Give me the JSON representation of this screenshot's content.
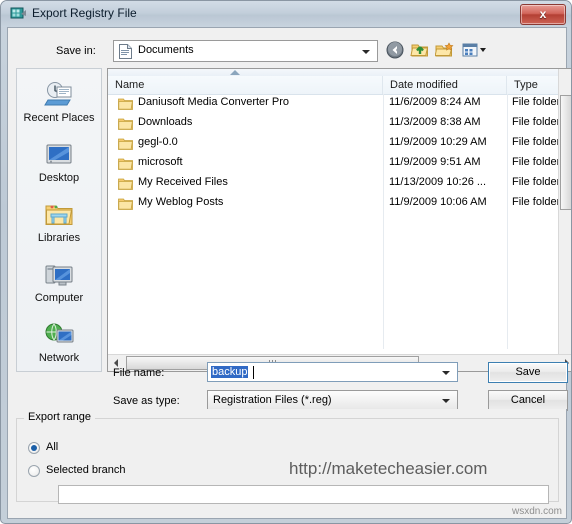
{
  "window": {
    "title": "Export Registry File",
    "title_icon": "registry-editor-icon",
    "close_label": "x"
  },
  "toolbar": {
    "save_in_label": "Save in:",
    "current_folder": "Documents",
    "folder_icon": "documents-icon",
    "buttons": [
      {
        "name": "back-button",
        "icon": "back-arrow-icon"
      },
      {
        "name": "up-one-level-button",
        "icon": "up-folder-icon"
      },
      {
        "name": "new-folder-button",
        "icon": "new-folder-icon"
      },
      {
        "name": "views-button",
        "icon": "views-icon"
      }
    ]
  },
  "places": {
    "items": [
      {
        "label": "Recent Places",
        "icon": "recent-places-icon"
      },
      {
        "label": "Desktop",
        "icon": "desktop-icon"
      },
      {
        "label": "Libraries",
        "icon": "libraries-icon"
      },
      {
        "label": "Computer",
        "icon": "computer-icon"
      },
      {
        "label": "Network",
        "icon": "network-icon"
      }
    ]
  },
  "filelist": {
    "columns": [
      "Name",
      "Date modified",
      "Type"
    ],
    "sort_column": "Name",
    "sort_direction": "ascending",
    "rows": [
      {
        "name": "Daniusoft Media Converter Pro",
        "date": "11/6/2009 8:24 AM",
        "type": "File folder"
      },
      {
        "name": "Downloads",
        "date": "11/3/2009 8:38 AM",
        "type": "File folder"
      },
      {
        "name": "gegl-0.0",
        "date": "11/9/2009 10:29 AM",
        "type": "File folder"
      },
      {
        "name": "microsoft",
        "date": "11/9/2009 9:51 AM",
        "type": "File folder"
      },
      {
        "name": "My Received Files",
        "date": "11/13/2009 10:26 ...",
        "type": "File folder"
      },
      {
        "name": "My Weblog Posts",
        "date": "11/9/2009 10:06 AM",
        "type": "File folder"
      }
    ]
  },
  "form": {
    "filename_label": "File name:",
    "filename_value": "backup",
    "filetype_label": "Save as type:",
    "filetype_value": "Registration Files (*.reg)",
    "save_label": "Save",
    "cancel_label": "Cancel"
  },
  "export_range": {
    "group_title": "Export range",
    "options": [
      {
        "label": "All",
        "selected": true
      },
      {
        "label": "Selected branch",
        "selected": false
      }
    ],
    "branch_value": ""
  },
  "watermarks": {
    "url": "http://maketecheasier.com",
    "site": "wsxdn.com"
  },
  "colors": {
    "selection": "#316ac5",
    "close_button": "#b33f33",
    "default_button_border": "#3c7fb1",
    "dialog_background": "#f0f0f0"
  }
}
